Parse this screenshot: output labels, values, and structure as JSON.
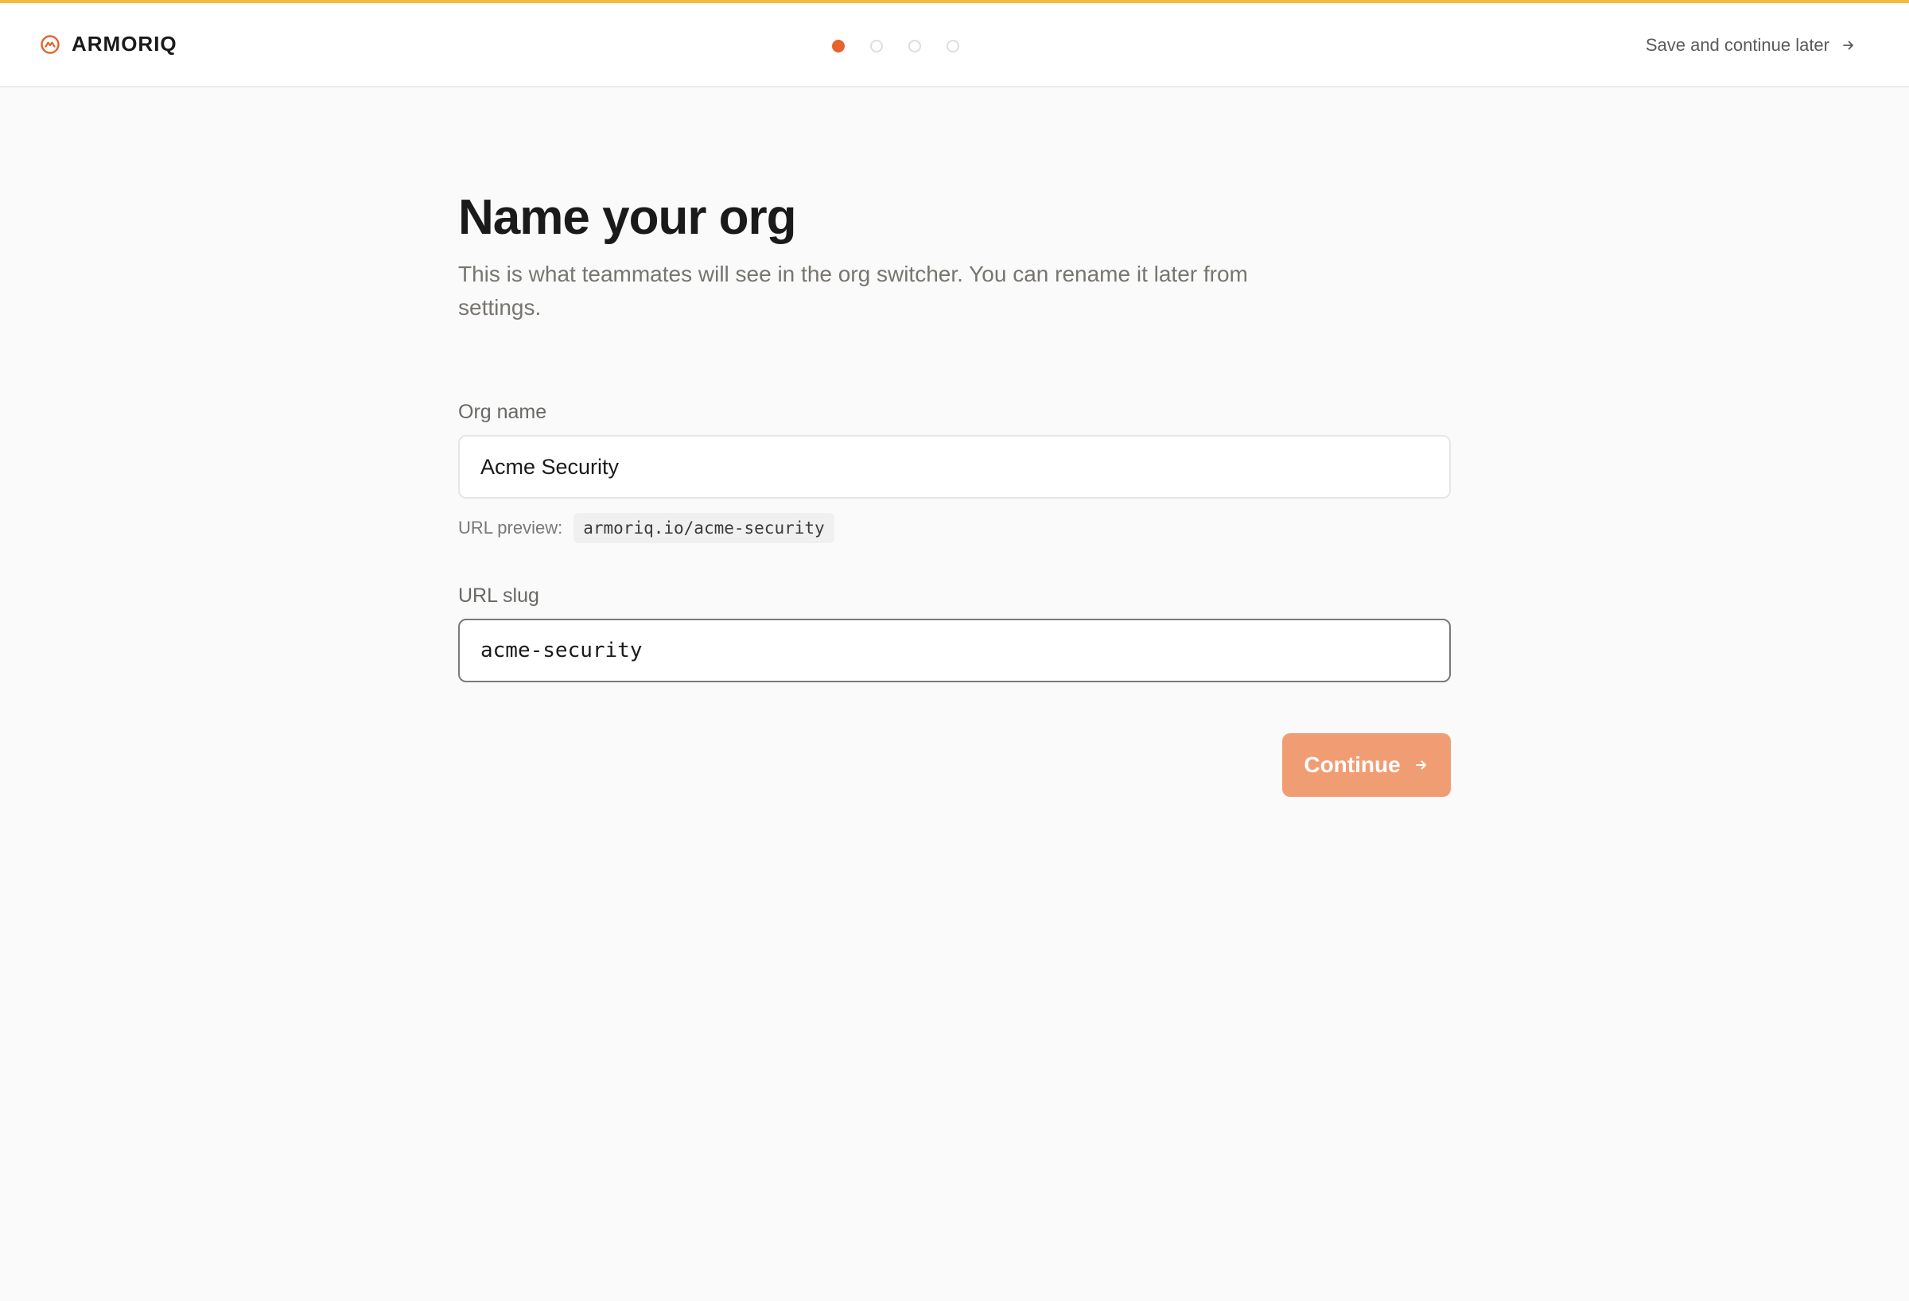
{
  "header": {
    "brand_name": "ARMORIQ",
    "save_later_label": "Save and continue later",
    "steps_total": 4,
    "current_step": 1
  },
  "main": {
    "title": "Name your org",
    "subtitle": "This is what teammates will see in the org switcher. You can rename it later from settings.",
    "org_name": {
      "label": "Org name",
      "value": "Acme Security"
    },
    "url_preview": {
      "label": "URL preview:",
      "value": "armoriq.io/acme-security"
    },
    "url_slug": {
      "label": "URL slug",
      "value": "acme-security"
    },
    "continue_label": "Continue"
  },
  "colors": {
    "accent": "#e8622c",
    "top_accent_bar": "#f5b942",
    "continue_button": "#f19d74",
    "background": "#fafafa"
  },
  "icons": {
    "brand": "armoriq-logo-icon",
    "save_later": "arrow-right-icon",
    "continue": "arrow-right-icon"
  }
}
